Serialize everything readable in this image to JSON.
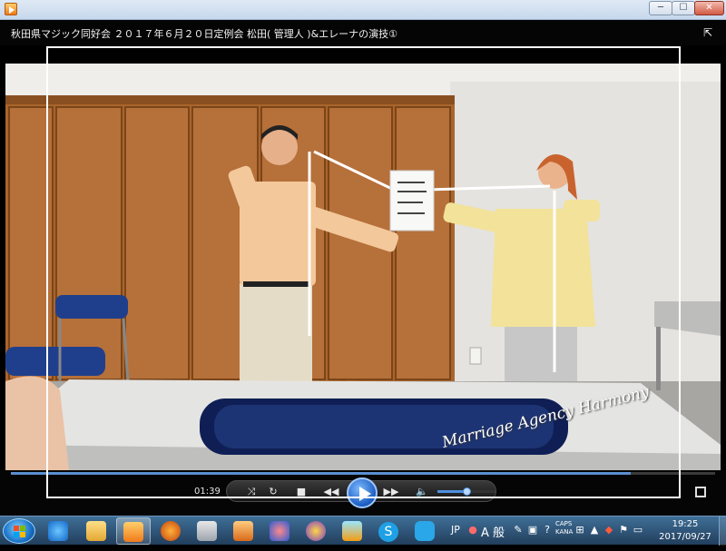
{
  "window": {
    "caption_buttons": {
      "minimize": "─",
      "maximize": "☐",
      "close": "✕"
    }
  },
  "player": {
    "title": "秋田県マジック同好会 ２０１７年６月２０日定例会 松田( 管理人 )&エレーナの演技①",
    "time_elapsed": "01:39",
    "seek_progress": 0.88,
    "volume_level": 0.5,
    "watermark": "Marriage Agency Harmony"
  },
  "taskbar": {
    "language": "JP",
    "ime_mode": "A 般",
    "caps": "CAPS",
    "kana": "KANA",
    "clock_time": "19:25",
    "clock_date": "2017/09/27"
  },
  "colors": {
    "accent": "#5a8fd0",
    "taskbar": "#2d557d"
  }
}
